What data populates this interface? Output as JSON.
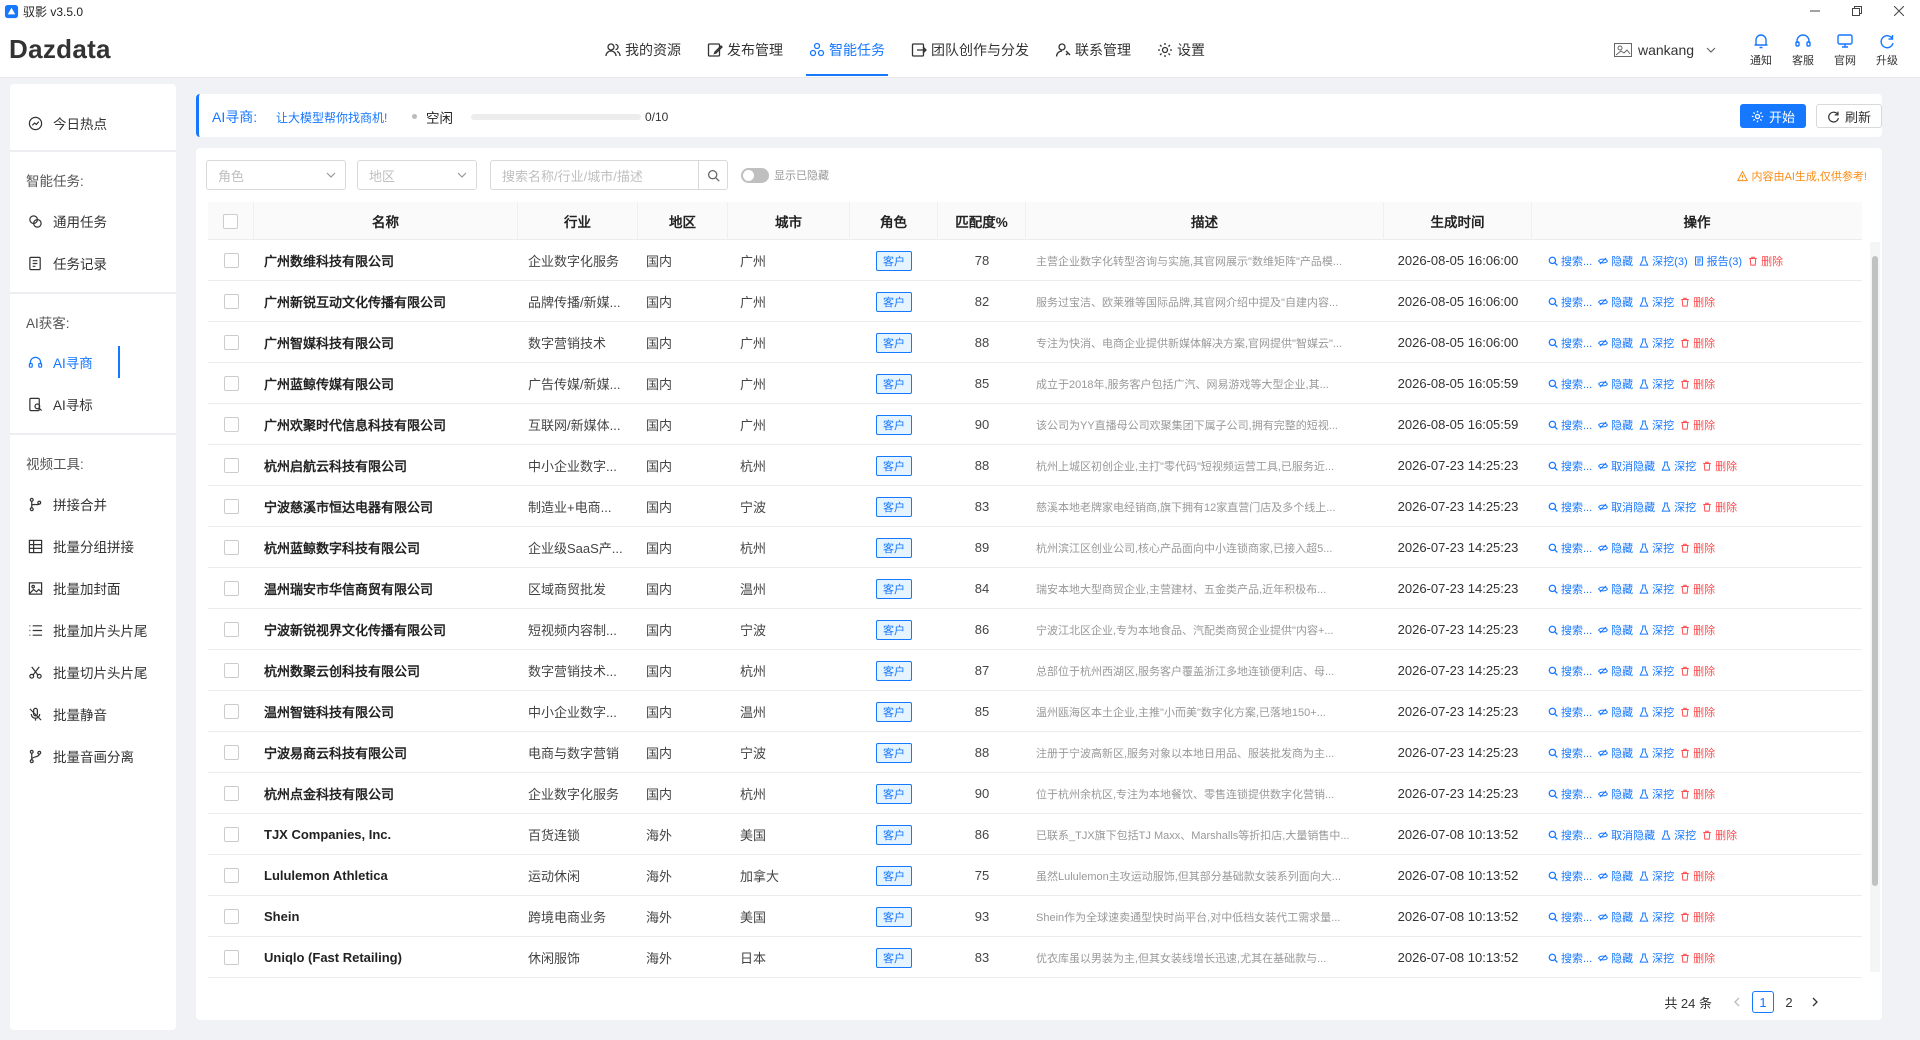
{
  "window": {
    "title": "驭影 v3.5.0"
  },
  "brand": "Dazdata",
  "nav": [
    {
      "label": "我的资源",
      "icon": "users-icon"
    },
    {
      "label": "发布管理",
      "icon": "edit-icon"
    },
    {
      "label": "智能任务",
      "icon": "cluster-icon",
      "active": true
    },
    {
      "label": "团队创作与分发",
      "icon": "share-icon"
    },
    {
      "label": "联系管理",
      "icon": "contact-icon"
    },
    {
      "label": "设置",
      "icon": "gear-icon"
    }
  ],
  "user": {
    "name": "wankang"
  },
  "header_icons": [
    {
      "label": "通知",
      "icon": "bell-icon"
    },
    {
      "label": "客服",
      "icon": "headset-icon"
    },
    {
      "label": "官网",
      "icon": "monitor-icon"
    },
    {
      "label": "升级",
      "icon": "refresh-icon"
    }
  ],
  "sidebar": {
    "hot": "今日热点",
    "group_tasks": "智能任务:",
    "tasks": [
      "通用任务",
      "任务记录"
    ],
    "group_leads": "AI获客:",
    "leads": [
      "AI寻商",
      "AI寻标"
    ],
    "group_video": "视频工具:",
    "video": [
      "拼接合并",
      "批量分组拼接",
      "批量加封面",
      "批量加片头片尾",
      "批量切片头片尾",
      "批量静音",
      "批量音画分离"
    ]
  },
  "toppanel": {
    "label": "AI寻商:",
    "sub": "让大模型帮你找商机!",
    "status": "空闲",
    "progress_text": "0/10",
    "progress": 0,
    "start_label": "开始",
    "refresh_label": "刷新"
  },
  "filters": {
    "role_placeholder": "角色",
    "region_placeholder": "地区",
    "search_placeholder": "搜索名称/行业/城市/描述",
    "show_hidden_label": "显示已隐藏",
    "ai_notice": "内容由AI生成,仅供参考!"
  },
  "columns": [
    "名称",
    "行业",
    "地区",
    "城市",
    "角色",
    "匹配度%",
    "描述",
    "生成时间",
    "操作"
  ],
  "ops_labels": {
    "search": "搜索...",
    "hide": "隐藏",
    "unhide": "取消隐藏",
    "dig": "深挖",
    "report": "报告(3)",
    "delete": "删除",
    "dig3": "深挖(3)"
  },
  "rows": [
    {
      "name": "广州数维科技有限公司",
      "industry": "企业数字化服务",
      "region": "国内",
      "city": "广州",
      "role": "客户",
      "match": "78",
      "desc": "主营企业数字化转型咨询与实施,其官网展示\"数维矩阵\"产品模...",
      "time": "2026-08-05 16:06:00",
      "hidden": false,
      "extended": true
    },
    {
      "name": "广州新锐互动文化传播有限公司",
      "industry": "品牌传播/新媒...",
      "region": "国内",
      "city": "广州",
      "role": "客户",
      "match": "82",
      "desc": "服务过宝洁、欧莱雅等国际品牌,其官网介绍中提及\"自建内容...",
      "time": "2026-08-05 16:06:00",
      "hidden": false
    },
    {
      "name": "广州智媒科技有限公司",
      "industry": "数字营销技术",
      "region": "国内",
      "city": "广州",
      "role": "客户",
      "match": "88",
      "desc": "专注为快消、电商企业提供新媒体解决方案,官网提供\"智媒云\"...",
      "time": "2026-08-05 16:06:00",
      "hidden": false
    },
    {
      "name": "广州蓝鲸传媒有限公司",
      "industry": "广告传媒/新媒...",
      "region": "国内",
      "city": "广州",
      "role": "客户",
      "match": "85",
      "desc": "成立于2018年,服务客户包括广汽、网易游戏等大型企业,其...",
      "time": "2026-08-05 16:05:59",
      "hidden": false
    },
    {
      "name": "广州欢聚时代信息科技有限公司",
      "industry": "互联网/新媒体...",
      "region": "国内",
      "city": "广州",
      "role": "客户",
      "match": "90",
      "desc": "该公司为YY直播母公司欢聚集团下属子公司,拥有完整的短视...",
      "time": "2026-08-05 16:05:59",
      "hidden": false
    },
    {
      "name": "杭州启航云科技有限公司",
      "industry": "中小企业数字...",
      "region": "国内",
      "city": "杭州",
      "role": "客户",
      "match": "88",
      "desc": "杭州上城区初创企业,主打\"零代码\"短视频运营工具,已服务近...",
      "time": "2026-07-23 14:25:23",
      "hidden": true
    },
    {
      "name": "宁波慈溪市恒达电器有限公司",
      "industry": "制造业+电商...",
      "region": "国内",
      "city": "宁波",
      "role": "客户",
      "match": "83",
      "desc": "慈溪本地老牌家电经销商,旗下拥有12家直营门店及多个线上...",
      "time": "2026-07-23 14:25:23",
      "hidden": true
    },
    {
      "name": "杭州蓝鲸数字科技有限公司",
      "industry": "企业级SaaS产...",
      "region": "国内",
      "city": "杭州",
      "role": "客户",
      "match": "89",
      "desc": "杭州滨江区创业公司,核心产品面向中小连锁商家,已接入超5...",
      "time": "2026-07-23 14:25:23",
      "hidden": false
    },
    {
      "name": "温州瑞安市华信商贸有限公司",
      "industry": "区域商贸批发",
      "region": "国内",
      "city": "温州",
      "role": "客户",
      "match": "84",
      "desc": "瑞安本地大型商贸企业,主营建材、五金类产品,近年积极布...",
      "time": "2026-07-23 14:25:23",
      "hidden": false
    },
    {
      "name": "宁波新锐视界文化传播有限公司",
      "industry": "短视频内容制...",
      "region": "国内",
      "city": "宁波",
      "role": "客户",
      "match": "86",
      "desc": "宁波江北区企业,专为本地食品、汽配类商贸企业提供\"内容+...",
      "time": "2026-07-23 14:25:23",
      "hidden": false
    },
    {
      "name": "杭州数聚云创科技有限公司",
      "industry": "数字营销技术...",
      "region": "国内",
      "city": "杭州",
      "role": "客户",
      "match": "87",
      "desc": "总部位于杭州西湖区,服务客户覆盖浙江多地连锁便利店、母...",
      "time": "2026-07-23 14:25:23",
      "hidden": false
    },
    {
      "name": "温州智链科技有限公司",
      "industry": "中小企业数字...",
      "region": "国内",
      "city": "温州",
      "role": "客户",
      "match": "85",
      "desc": "温州瓯海区本土企业,主推\"小而美\"数字化方案,已落地150+...",
      "time": "2026-07-23 14:25:23",
      "hidden": false
    },
    {
      "name": "宁波易商云科技有限公司",
      "industry": "电商与数字营销",
      "region": "国内",
      "city": "宁波",
      "role": "客户",
      "match": "88",
      "desc": "注册于宁波高新区,服务对象以本地日用品、服装批发商为主...",
      "time": "2026-07-23 14:25:23",
      "hidden": false
    },
    {
      "name": "杭州点金科技有限公司",
      "industry": "企业数字化服务",
      "region": "国内",
      "city": "杭州",
      "role": "客户",
      "match": "90",
      "desc": "位于杭州余杭区,专注为本地餐饮、零售连锁提供数字化营销...",
      "time": "2026-07-23 14:25:23",
      "hidden": false
    },
    {
      "name": "TJX Companies, Inc.",
      "industry": "百货连锁",
      "region": "海外",
      "city": "美国",
      "role": "客户",
      "match": "86",
      "desc": "已联系_TJX旗下包括TJ Maxx、Marshalls等折扣店,大量销售中...",
      "time": "2026-07-08 10:13:52",
      "hidden": true
    },
    {
      "name": "Lululemon Athletica",
      "industry": "运动休闲",
      "region": "海外",
      "city": "加拿大",
      "role": "客户",
      "match": "75",
      "desc": "虽然Lululemon主攻运动服饰,但其部分基础款女装系列面向大...",
      "time": "2026-07-08 10:13:52",
      "hidden": false
    },
    {
      "name": "Shein",
      "industry": "跨境电商业务",
      "region": "海外",
      "city": "美国",
      "role": "客户",
      "match": "93",
      "desc": "Shein作为全球速卖通型快时尚平台,对中低档女装代工需求量...",
      "time": "2026-07-08 10:13:52",
      "hidden": false
    },
    {
      "name": "Uniqlo (Fast Retailing)",
      "industry": "休闲服饰",
      "region": "海外",
      "city": "日本",
      "role": "客户",
      "match": "83",
      "desc": "优衣库虽以男装为主,但其女装线增长迅速,尤其在基础款与...",
      "time": "2026-07-08 10:13:52",
      "hidden": false
    }
  ],
  "pager": {
    "total": "共 24 条",
    "pages": [
      "1",
      "2"
    ],
    "current": "1"
  },
  "colors": {
    "accent": "#1677ff",
    "danger": "#ff4d4f",
    "warning": "#fa8c16"
  }
}
